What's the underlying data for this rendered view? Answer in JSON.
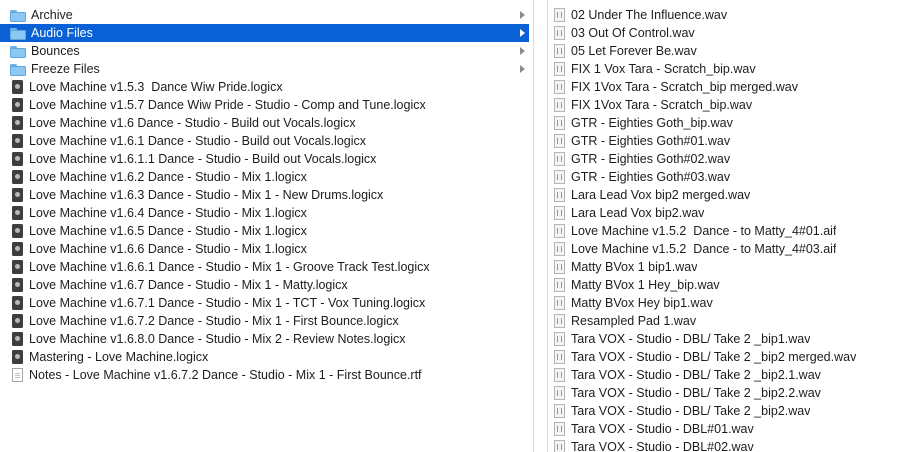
{
  "column1": {
    "items": [
      {
        "label": "Archive",
        "icon": "folder-icon",
        "kind": "folder",
        "selected": false
      },
      {
        "label": "Audio Files",
        "icon": "folder-icon",
        "kind": "folder",
        "selected": true
      },
      {
        "label": "Bounces",
        "icon": "folder-icon",
        "kind": "folder",
        "selected": false
      },
      {
        "label": "Freeze Files",
        "icon": "folder-icon",
        "kind": "folder",
        "selected": false
      },
      {
        "label": "Love Machine v1.5.3  Dance Wiw Pride.logicx",
        "icon": "logic-project-icon",
        "kind": "logic"
      },
      {
        "label": "Love Machine v1.5.7 Dance Wiw Pride - Studio - Comp and Tune.logicx",
        "icon": "logic-project-icon",
        "kind": "logic"
      },
      {
        "label": "Love Machine v1.6 Dance - Studio - Build out Vocals.logicx",
        "icon": "logic-project-icon",
        "kind": "logic"
      },
      {
        "label": "Love Machine v1.6.1 Dance - Studio - Build out Vocals.logicx",
        "icon": "logic-project-icon",
        "kind": "logic"
      },
      {
        "label": "Love Machine v1.6.1.1 Dance - Studio - Build out Vocals.logicx",
        "icon": "logic-project-icon",
        "kind": "logic"
      },
      {
        "label": "Love Machine v1.6.2 Dance - Studio - Mix 1.logicx",
        "icon": "logic-project-icon",
        "kind": "logic"
      },
      {
        "label": "Love Machine v1.6.3 Dance - Studio - Mix 1 - New Drums.logicx",
        "icon": "logic-project-icon",
        "kind": "logic"
      },
      {
        "label": "Love Machine v1.6.4 Dance - Studio - Mix 1.logicx",
        "icon": "logic-project-icon",
        "kind": "logic"
      },
      {
        "label": "Love Machine v1.6.5 Dance - Studio - Mix 1.logicx",
        "icon": "logic-project-icon",
        "kind": "logic"
      },
      {
        "label": "Love Machine v1.6.6 Dance - Studio - Mix 1.logicx",
        "icon": "logic-project-icon",
        "kind": "logic"
      },
      {
        "label": "Love Machine v1.6.6.1 Dance - Studio - Mix 1 - Groove Track Test.logicx",
        "icon": "logic-project-icon",
        "kind": "logic"
      },
      {
        "label": "Love Machine v1.6.7 Dance - Studio - Mix 1 - Matty.logicx",
        "icon": "logic-project-icon",
        "kind": "logic"
      },
      {
        "label": "Love Machine v1.6.7.1 Dance - Studio - Mix 1 - TCT - Vox Tuning.logicx",
        "icon": "logic-project-icon",
        "kind": "logic"
      },
      {
        "label": "Love Machine v1.6.7.2 Dance - Studio - Mix 1 - First Bounce.logicx",
        "icon": "logic-project-icon",
        "kind": "logic"
      },
      {
        "label": "Love Machine v1.6.8.0 Dance - Studio - Mix 2 - Review Notes.logicx",
        "icon": "logic-project-icon",
        "kind": "logic"
      },
      {
        "label": "Mastering - Love Machine.logicx",
        "icon": "logic-project-icon",
        "kind": "logic"
      },
      {
        "label": "Notes - Love Machine v1.6.7.2 Dance - Studio - Mix 1 - First Bounce.rtf",
        "icon": "rtf-document-icon",
        "kind": "doc"
      }
    ]
  },
  "column2": {
    "items": [
      {
        "label": "02 Under The Influence.wav"
      },
      {
        "label": "03 Out Of Control.wav"
      },
      {
        "label": "05 Let Forever Be.wav"
      },
      {
        "label": "FIX 1 Vox Tara - Scratch_bip.wav"
      },
      {
        "label": "FIX 1Vox Tara - Scratch_bip merged.wav"
      },
      {
        "label": "FIX 1Vox Tara - Scratch_bip.wav"
      },
      {
        "label": "GTR - Eighties Goth_bip.wav"
      },
      {
        "label": "GTR - Eighties Goth#01.wav"
      },
      {
        "label": "GTR - Eighties Goth#02.wav"
      },
      {
        "label": "GTR - Eighties Goth#03.wav"
      },
      {
        "label": "Lara Lead Vox bip2 merged.wav"
      },
      {
        "label": "Lara Lead Vox bip2.wav"
      },
      {
        "label": "Love Machine v1.5.2  Dance - to Matty_4#01.aif"
      },
      {
        "label": "Love Machine v1.5.2  Dance - to Matty_4#03.aif"
      },
      {
        "label": "Matty BVox 1 bip1.wav"
      },
      {
        "label": "Matty BVox 1 Hey_bip.wav"
      },
      {
        "label": "Matty BVox Hey bip1.wav"
      },
      {
        "label": "Resampled Pad 1.wav"
      },
      {
        "label": "Tara VOX - Studio - DBL/ Take 2 _bip1.wav"
      },
      {
        "label": "Tara VOX - Studio - DBL/ Take 2 _bip2 merged.wav"
      },
      {
        "label": "Tara VOX - Studio - DBL/ Take 2 _bip2.1.wav"
      },
      {
        "label": "Tara VOX - Studio - DBL/ Take 2 _bip2.2.wav"
      },
      {
        "label": "Tara VOX - Studio - DBL/ Take 2 _bip2.wav"
      },
      {
        "label": "Tara VOX - Studio - DBL#01.wav"
      },
      {
        "label": "Tara VOX - Studio - DBL#02.wav"
      }
    ],
    "icon": "audio-file-icon"
  },
  "colors": {
    "selection": "#0a60d5",
    "folder": "#8cc8f2",
    "divider": "#dcdcdc"
  }
}
